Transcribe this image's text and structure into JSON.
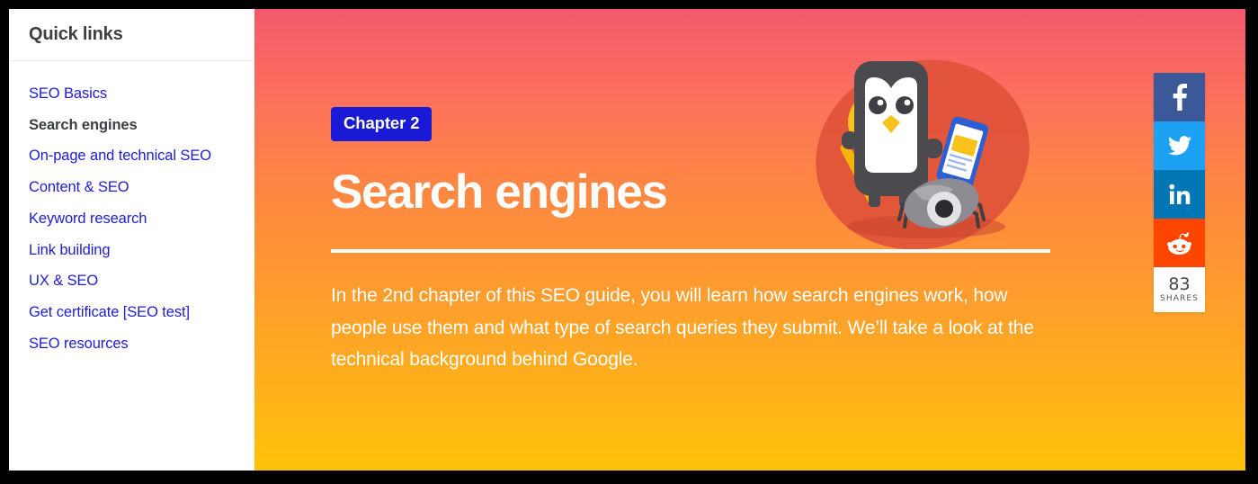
{
  "sidebar": {
    "title": "Quick links",
    "items": [
      {
        "label": "SEO Basics",
        "current": false
      },
      {
        "label": "Search engines",
        "current": true
      },
      {
        "label": "On-page and technical SEO",
        "current": false
      },
      {
        "label": "Content & SEO",
        "current": false
      },
      {
        "label": "Keyword research",
        "current": false
      },
      {
        "label": "Link building",
        "current": false
      },
      {
        "label": "UX & SEO",
        "current": false
      },
      {
        "label": "Get certificate [SEO test]",
        "current": false
      },
      {
        "label": "SEO resources",
        "current": false
      }
    ],
    "link_color": "#1d1dd4",
    "current_color": "#3c4043"
  },
  "hero": {
    "badge": "Chapter 2",
    "badge_color": "#1a1ad6",
    "title": "Search engines",
    "paragraph": "In the 2nd chapter of this SEO guide, you will learn how search engines work, how people use them and what type of search queries they submit. We’ll take a look at the technical background behind Google.",
    "gradient_top": "#f4596b",
    "gradient_bottom": "#ffc107",
    "text_color": "#ffffff"
  },
  "illustration": {
    "name": "seo-owl-mascot-illustration",
    "blob_color": "#e0523a",
    "parts": [
      {
        "name": "magnifier-icon",
        "color": "#ffc20e"
      },
      {
        "name": "owl-mascot",
        "color": "#4a4a4f"
      },
      {
        "name": "smartphone-icon",
        "color": "#2d5fd4"
      },
      {
        "name": "crawler-spider-icon",
        "color": "#8c8c92"
      }
    ]
  },
  "share": {
    "buttons": [
      {
        "name": "facebook",
        "glyph": "f",
        "color": "#3b5998"
      },
      {
        "name": "twitter",
        "glyph": "t",
        "color": "#1da1f2"
      },
      {
        "name": "linkedin",
        "glyph": "in",
        "color": "#0077b5"
      },
      {
        "name": "reddit",
        "glyph": "r",
        "color": "#ff4500"
      }
    ],
    "count": "83",
    "count_label": "SHARES"
  }
}
